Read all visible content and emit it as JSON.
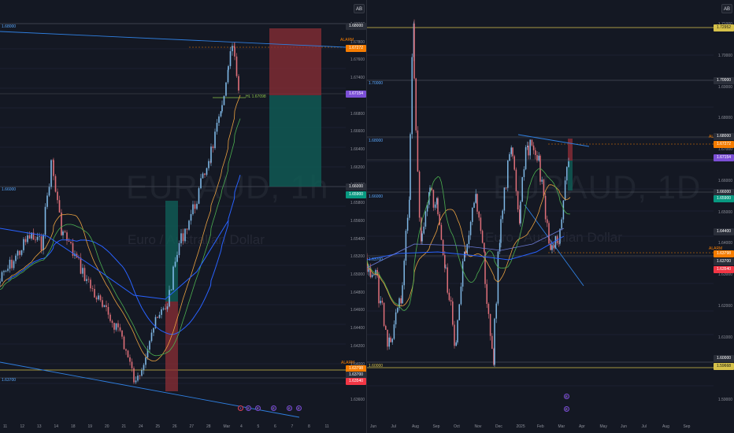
{
  "left": {
    "watermark_symbol": "EURAUD, 1h",
    "watermark_name": "Euro / Australian Dollar",
    "scale_button": "AB",
    "price_ticks": [
      "1.68000",
      "1.67800",
      "1.67600",
      "1.67400",
      "1.67200",
      "1.66800",
      "1.66600",
      "1.66400",
      "1.66200",
      "1.66000",
      "1.65800",
      "1.65600",
      "1.65400",
      "1.65200",
      "1.65000",
      "1.64800",
      "1.64600",
      "1.64400",
      "1.64200",
      "1.64000",
      "1.63800",
      "1.63600"
    ],
    "price_labels": [
      {
        "text": "1.68000",
        "color": "#2a2e39"
      },
      {
        "text": "1.67272",
        "color": "#f57c00"
      },
      {
        "text": "1.67154",
        "color": "#7b4fd6"
      },
      {
        "text": "1.66000",
        "color": "#2a2e39"
      },
      {
        "text": "1.65900",
        "color": "#089981"
      },
      {
        "text": "1.63798",
        "color": "#f57c00"
      },
      {
        "text": "1.63700",
        "color": "#2a2e39"
      },
      {
        "text": "1.63540",
        "color": "#f23645"
      }
    ],
    "level_texts": [
      "1.68000",
      "1.66000",
      "1.63700"
    ],
    "h_label": "HL 1.67098",
    "alarm_top": "ALARM",
    "alarm_bottom": "ALARM",
    "time_labels": [
      "11",
      "12",
      "13",
      "14",
      "18",
      "19",
      "20",
      "21",
      "24",
      "25",
      "26",
      "27",
      "28",
      "Mar",
      "4",
      "5",
      "6",
      "7",
      "8",
      "11"
    ],
    "event_markers": [
      "!",
      "E",
      "E",
      "E",
      "E",
      "E"
    ]
  },
  "right": {
    "watermark_symbol": "EURAUD, 1D",
    "watermark_name": "Euro / Australian Dollar",
    "scale_button": "AB",
    "price_ticks": [
      "1.71000",
      "1.70000",
      "1.69000",
      "1.68000",
      "1.67000",
      "1.66000",
      "1.65000",
      "1.64000",
      "1.63000",
      "1.62000",
      "1.61000",
      "1.60000",
      "1.59000"
    ],
    "price_labels": [
      {
        "text": "1.72952",
        "color": "#d6c14a"
      },
      {
        "text": "1.70000",
        "color": "#2a2e39"
      },
      {
        "text": "1.68000",
        "color": "#2a2e39"
      },
      {
        "text": "1.67272",
        "color": "#f57c00"
      },
      {
        "text": "1.67154",
        "color": "#7b4fd6"
      },
      {
        "text": "1.66000",
        "color": "#2a2e39"
      },
      {
        "text": "1.65900",
        "color": "#089981"
      },
      {
        "text": "1.64400",
        "color": "#2a2e39"
      },
      {
        "text": "1.63798",
        "color": "#f57c00"
      },
      {
        "text": "1.63700",
        "color": "#2a2e39"
      },
      {
        "text": "1.63540",
        "color": "#f23645"
      },
      {
        "text": "1.60000",
        "color": "#2a2e39"
      },
      {
        "text": "1.59668",
        "color": "#d6c14a"
      }
    ],
    "level_texts": [
      "1.70000",
      "1.68000",
      "1.66000",
      "1.63700",
      "1.60000"
    ],
    "alarm_top": "ALARM",
    "alarm_bottom": "ALARM",
    "time_labels": [
      "Jun",
      "Jul",
      "Aug",
      "Sep",
      "Oct",
      "Nov",
      "Dec",
      "2025",
      "Feb",
      "Mar",
      "Apr",
      "May",
      "Jun",
      "Jul",
      "Aug",
      "Sep"
    ],
    "event_markers": [
      "E",
      "E"
    ]
  },
  "colors": {
    "background": "#141823",
    "up": "#7fb8e6",
    "down": "#e0707a",
    "ma_blue": "#2962ff",
    "ma_orange": "#e8a040",
    "ma_green": "#4caf50",
    "trendline": "#2f7fe0",
    "level_line": "#3a3e4a",
    "yellow_line": "#d6c14a",
    "orange_line": "#f57c00",
    "stop_zone": "#8b2d36",
    "target_zone": "#0f5e56"
  }
}
